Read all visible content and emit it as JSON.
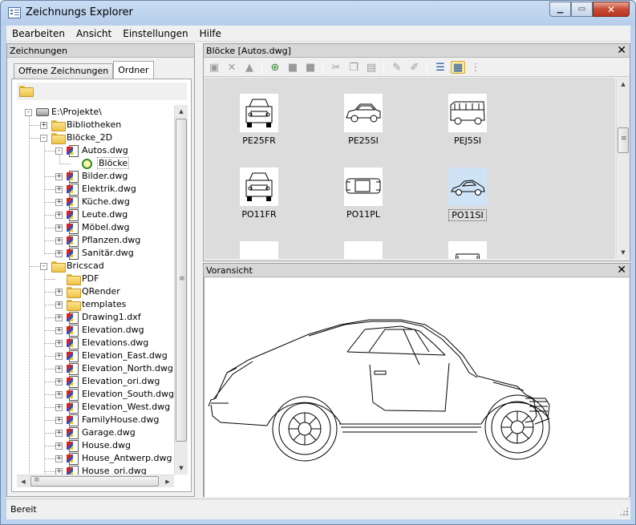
{
  "window": {
    "title": "Zeichnungs Explorer"
  },
  "menubar": {
    "items": [
      "Bearbeiten",
      "Ansicht",
      "Einstellungen",
      "Hilfe"
    ]
  },
  "left_pane": {
    "title": "Zeichnungen",
    "tabs": [
      "Offene Zeichnungen",
      "Ordner"
    ],
    "active_tab": "Ordner",
    "tree": [
      {
        "label": "E:\\Projekte\\",
        "type": "drive",
        "level": 0,
        "expander": "-"
      },
      {
        "label": "Bibliotheken",
        "type": "folder",
        "level": 1,
        "expander": "+"
      },
      {
        "label": "Blöcke_2D",
        "type": "folder-open",
        "level": 1,
        "expander": "-"
      },
      {
        "label": "Autos.dwg",
        "type": "dwg",
        "level": 2,
        "expander": "-"
      },
      {
        "label": "Blöcke",
        "type": "blocks",
        "level": 3,
        "selected": true
      },
      {
        "label": "Bilder.dwg",
        "type": "dwg",
        "level": 2,
        "expander": "+"
      },
      {
        "label": "Elektrik.dwg",
        "type": "dwg",
        "level": 2,
        "expander": "+"
      },
      {
        "label": "Küche.dwg",
        "type": "dwg",
        "level": 2,
        "expander": "+"
      },
      {
        "label": "Leute.dwg",
        "type": "dwg",
        "level": 2,
        "expander": "+"
      },
      {
        "label": "Möbel.dwg",
        "type": "dwg",
        "level": 2,
        "expander": "+"
      },
      {
        "label": "Pflanzen.dwg",
        "type": "dwg",
        "level": 2,
        "expander": "+"
      },
      {
        "label": "Sanitär.dwg",
        "type": "dwg",
        "level": 2,
        "expander": "+"
      },
      {
        "label": "Bricscad",
        "type": "folder-open",
        "level": 1,
        "expander": "-"
      },
      {
        "label": "PDF",
        "type": "folder",
        "level": 2
      },
      {
        "label": "QRender",
        "type": "folder",
        "level": 2,
        "expander": "+"
      },
      {
        "label": "templates",
        "type": "folder",
        "level": 2,
        "expander": "+"
      },
      {
        "label": "Drawing1.dxf",
        "type": "dwg",
        "level": 2,
        "expander": "+"
      },
      {
        "label": "Elevation.dwg",
        "type": "dwg",
        "level": 2,
        "expander": "+"
      },
      {
        "label": "Elevations.dwg",
        "type": "dwg",
        "level": 2,
        "expander": "+"
      },
      {
        "label": "Elevation_East.dwg",
        "type": "dwg",
        "level": 2,
        "expander": "+"
      },
      {
        "label": "Elevation_North.dwg",
        "type": "dwg",
        "level": 2,
        "expander": "+"
      },
      {
        "label": "Elevation_ori.dwg",
        "type": "dwg",
        "level": 2,
        "expander": "+"
      },
      {
        "label": "Elevation_South.dwg",
        "type": "dwg",
        "level": 2,
        "expander": "+"
      },
      {
        "label": "Elevation_West.dwg",
        "type": "dwg",
        "level": 2,
        "expander": "+"
      },
      {
        "label": "FamilyHouse.dwg",
        "type": "dwg",
        "level": 2,
        "expander": "+"
      },
      {
        "label": "Garage.dwg",
        "type": "dwg",
        "level": 2,
        "expander": "+"
      },
      {
        "label": "House.dwg",
        "type": "dwg",
        "level": 2,
        "expander": "+"
      },
      {
        "label": "House_Antwerp.dwg",
        "type": "dwg",
        "level": 2,
        "expander": "+"
      },
      {
        "label": "House_ori.dwg",
        "type": "dwg",
        "level": 2,
        "expander": "+"
      }
    ]
  },
  "blocks_pane": {
    "title": "Blöcke [Autos.dwg]",
    "toolbar_icons": [
      "paste-icon",
      "delete-icon",
      "purge-icon",
      "insert-block-icon",
      "insert-as-icon",
      "replace-icon",
      "cut-icon",
      "copy-icon",
      "paste-clipboard-icon",
      "edit-icon",
      "redefine-icon",
      "details-view-icon",
      "thumbnail-view-icon",
      "tree-view-icon"
    ],
    "blocks": [
      {
        "name": "PE25FR",
        "view": "front"
      },
      {
        "name": "PE25SI",
        "view": "side"
      },
      {
        "name": "PEJ5SI",
        "view": "van"
      },
      {
        "name": "PO11FR",
        "view": "front"
      },
      {
        "name": "PO11PL",
        "view": "plan"
      },
      {
        "name": "PO11SI",
        "view": "side-coupe",
        "selected": true
      },
      {
        "name": "",
        "view": "partial-a"
      },
      {
        "name": "",
        "view": "partial-b"
      },
      {
        "name": "",
        "view": "partial-c"
      }
    ]
  },
  "preview_pane": {
    "title": "Voransicht"
  },
  "status": {
    "text": "Bereit"
  },
  "colors": {
    "accent": "#1c55a8",
    "selection": "#cfe3f7",
    "pane_header": "#d7d7d7"
  }
}
